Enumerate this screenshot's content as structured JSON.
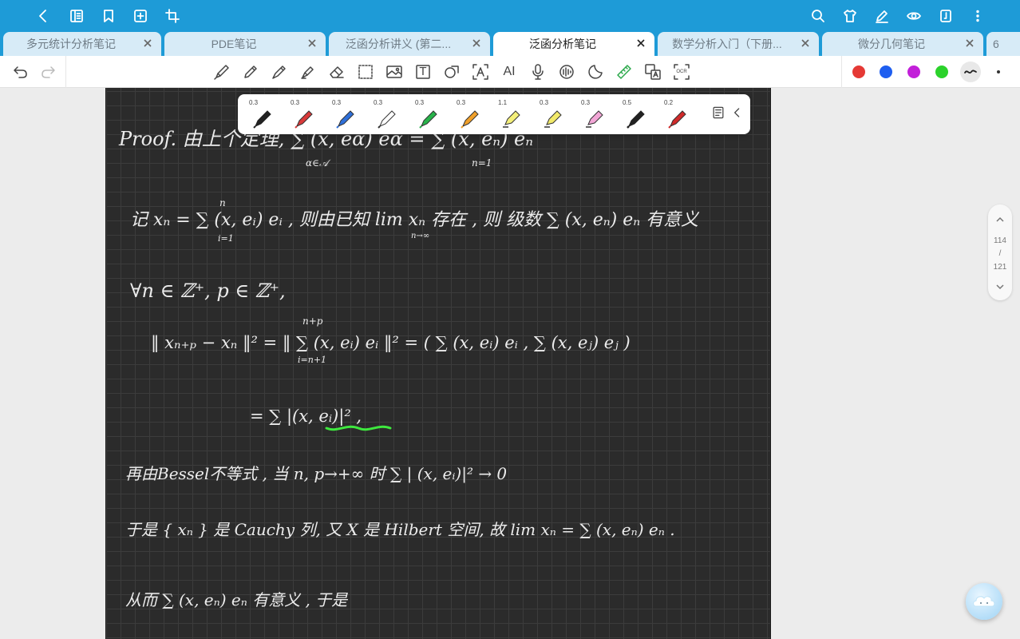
{
  "tabs": [
    {
      "label": "多元统计分析笔记",
      "active": false
    },
    {
      "label": "PDE笔记",
      "active": false
    },
    {
      "label": "泛函分析讲义 (第二...",
      "active": false
    },
    {
      "label": "泛函分析笔记",
      "active": true
    },
    {
      "label": "数学分析入门（下册...",
      "active": false
    },
    {
      "label": "微分几何笔记",
      "active": false
    }
  ],
  "tab_overflow": "6",
  "colors": {
    "accent": "#1e9bd7",
    "red": "#e53935",
    "blue": "#1e5ef0",
    "purple": "#c21fd9",
    "green": "#2bd22b"
  },
  "pens": [
    {
      "size": "0.3",
      "color": "#222222"
    },
    {
      "size": "0.3",
      "color": "#d93a3a"
    },
    {
      "size": "0.3",
      "color": "#2f6fd8"
    },
    {
      "size": "0.3",
      "color": "#ffffff"
    },
    {
      "size": "0.3",
      "color": "#27b34a"
    },
    {
      "size": "0.3",
      "color": "#f0a02a"
    },
    {
      "size": "1.1",
      "color": "#f4ef7a"
    },
    {
      "size": "0.3",
      "color": "#f2ea6a"
    },
    {
      "size": "0.3",
      "color": "#f2a6d6"
    },
    {
      "size": "0.5",
      "color": "#222222"
    },
    {
      "size": "0.2",
      "color": "#d02a2a"
    }
  ],
  "toolbar": {
    "text_tool": "T",
    "ai_label": "AI",
    "ocr_label": "OCR"
  },
  "pager": {
    "current": "114",
    "sep": "/",
    "total": "121"
  },
  "note": {
    "line1": "Proof. 由上个定理, ∑ (x, eα) eα = ∑ (x, eₙ) eₙ",
    "line1_sub_a": "α∈𝒜",
    "line1_sub_b": "n=1",
    "line2": "记 xₙ = ∑ (x, eᵢ) eᵢ , 则由已知 lim xₙ 存在 , 则 级数 ∑ (x, eₙ) eₙ 有意义",
    "line2_sub_a": "i=1",
    "line2_sub_b": "n→∞",
    "line3": "∀n ∈ ℤ⁺, p ∈ ℤ⁺,",
    "line4": "‖ xₙ₊ₚ − xₙ ‖² = ‖ ∑ (x, eᵢ) eᵢ ‖² = ( ∑ (x, eᵢ) eᵢ , ∑ (x, eⱼ) eⱼ )",
    "line4_sub": "i=n+1",
    "line4_sup": "n+p",
    "line5": "= ∑ |(x, eᵢ)|² ,",
    "line6": "再由Bessel不等式 , 当 n, p→+∞ 时      ∑ | (x, eᵢ)|² → 0",
    "line7": "于是 { xₙ } 是 Cauchy 列,   又 X 是 Hilbert 空间,   故  lim xₙ = ∑ (x, eₙ) eₙ  .",
    "line8": "从而  ∑ (x, eₙ) eₙ  有意义 ,   于是",
    "sum_top": "∞",
    "sum_top_n": "n"
  }
}
